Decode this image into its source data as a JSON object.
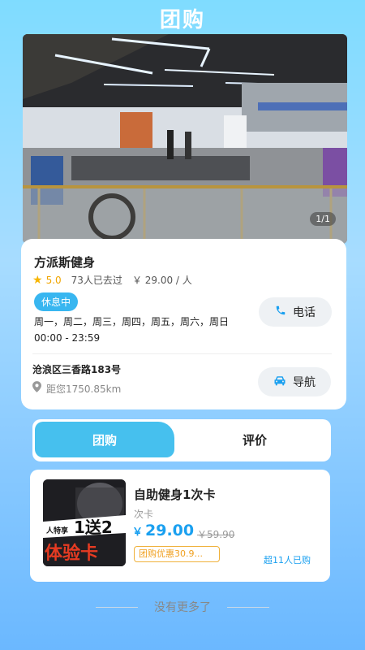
{
  "header": {
    "title": "团购"
  },
  "gallery": {
    "counter": "1/1"
  },
  "shop": {
    "name": "方派斯健身",
    "rating": "5.0",
    "visits": "73人已去过",
    "price_per_person": "￥ 29.00 / 人",
    "status": "休息中",
    "open_days": "周一，周二，周三，周四，周五，周六，周日",
    "open_hours": "00:00 - 23:59",
    "call_label": "电话",
    "address": "沧浪区三香路183号",
    "distance": "距您1750.85km",
    "navigate_label": "导航"
  },
  "tabs": [
    {
      "label": "团购",
      "active": true
    },
    {
      "label": "评价",
      "active": false
    }
  ],
  "deals": [
    {
      "title": "自助健身1次卡",
      "type": "次卡",
      "currency": "￥",
      "price": "29.00",
      "original_price": "￥59.90",
      "discount": "团购优惠30.9...",
      "sold": "超11人已购",
      "thumb_text_main": "1送2",
      "thumb_text_sub": "体验卡",
      "thumb_text_small": "人特享"
    }
  ],
  "footer": {
    "no_more": "没有更多了"
  },
  "icons": {
    "star": "star-icon",
    "phone": "phone-icon",
    "car": "car-icon",
    "pin": "location-pin-icon"
  },
  "colors": {
    "accent": "#46c0ee",
    "price": "#1aa0f0",
    "rating": "#f0a500",
    "discount": "#f0a020"
  }
}
